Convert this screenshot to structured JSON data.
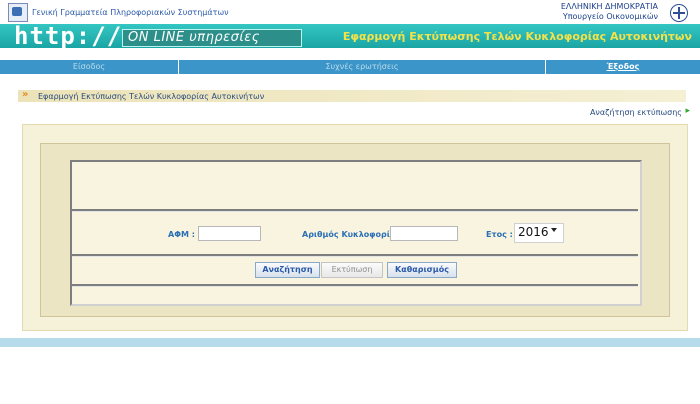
{
  "header": {
    "org_name": "Γενική Γραμματεία Πληροφοριακών Συστημάτων",
    "country": "ΕΛΛΗΝΙΚΗ ΔΗΜΟΚΡΑΤΙΑ",
    "ministry": "Υπουργείο Οικονομικών"
  },
  "banner": {
    "http_text": "http://",
    "online_text": "ΟΝ LINE υπηρεσίες",
    "app_title": "Εφαρμογή Εκτύπωσης Τελών Κυκλοφορίας Αυτοκινήτων"
  },
  "nav": {
    "items": [
      "Είσοδος",
      "Συχνές ερωτήσεις",
      "Έξοδος"
    ]
  },
  "breadcrumb": {
    "title": "Εφαρμογή Εκτύπωσης Τελών Κυκλοφορίας Αυτοκινήτων",
    "arrow": "»"
  },
  "links": {
    "search_print": "Αναζήτηση εκτύπωσης",
    "arrow": "▸"
  },
  "form": {
    "afm_label": "ΑΦΜ :",
    "afm_value": "",
    "plate_label": "Αριθμός Κυκλοφορίας :",
    "plate_value": "",
    "year_label": "Ετος :",
    "year_value": "2016"
  },
  "buttons": {
    "search": "Αναζήτηση",
    "print": "Εκτύπωση",
    "clear": "Καθαρισμός"
  },
  "colors": {
    "banner": "#1aa5a4",
    "nav": "#3b95c8",
    "accent_yellow": "#f3e24a",
    "label_blue": "#2b6fb5"
  }
}
